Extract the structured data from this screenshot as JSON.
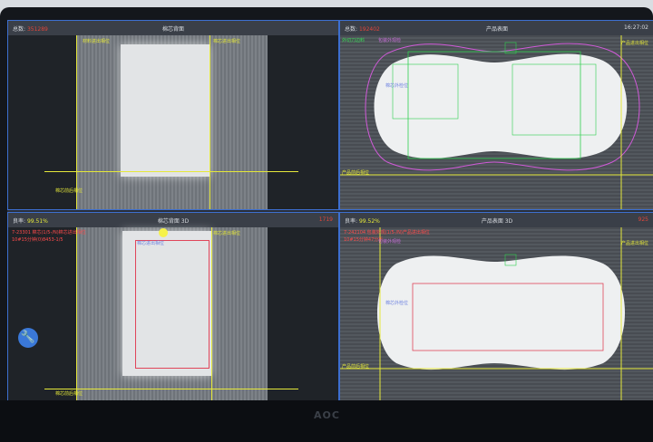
{
  "monitor": {
    "brand": "AOC"
  },
  "panels": {
    "top_left": {
      "count_label": "总数:",
      "count_value": "351289",
      "title": "棉芯背面",
      "labels": {
        "a": "材料进出相位",
        "b": "棉芯进出相位",
        "c": "棉芯前后相位"
      }
    },
    "top_right": {
      "count_label": "总数:",
      "count_value": "192402",
      "title": "产品表面",
      "time": "16:27:02",
      "labels": {
        "a": "外切刀边料",
        "b": "包装外观检",
        "c": "产品进出相位",
        "d": "棉芯外检位",
        "e": "产品前后相位"
      }
    },
    "bottom_left": {
      "yield_label": "良率:",
      "yield_value": "99.51%",
      "title": "棉芯背面 3D",
      "count_value": "1719",
      "log_line1": "7-23301 棉芯(1/5-/N)棉芯进出相位",
      "log_line2": "10#15分钟(0)8453-1/5",
      "labels": {
        "a": "棉芯进出相位",
        "b": "棉芯进出相位",
        "c": "棉芯前后相位"
      }
    },
    "bottom_right": {
      "yield_label": "良率:",
      "yield_value": "99.52%",
      "title": "产品表面 3D",
      "count_value": "925",
      "log_line1": "7-242104 包装外观(1/5-/N)产品进出相位",
      "log_line2": "10#15分钟47分析",
      "labels": {
        "a": "包装外观检",
        "b": "产品进出相位",
        "c": "产品前后相位",
        "d": "棉芯外检位"
      }
    }
  },
  "icons": {
    "wrench": "wrench-icon",
    "indicator": "yellow-dot-indicator"
  },
  "colors": {
    "accent": "#3d6fd0",
    "guide_yellow": "#e5e83a",
    "guide_green": "#2fd04f",
    "magenta": "#c86cd8",
    "red": "#e0453a"
  }
}
